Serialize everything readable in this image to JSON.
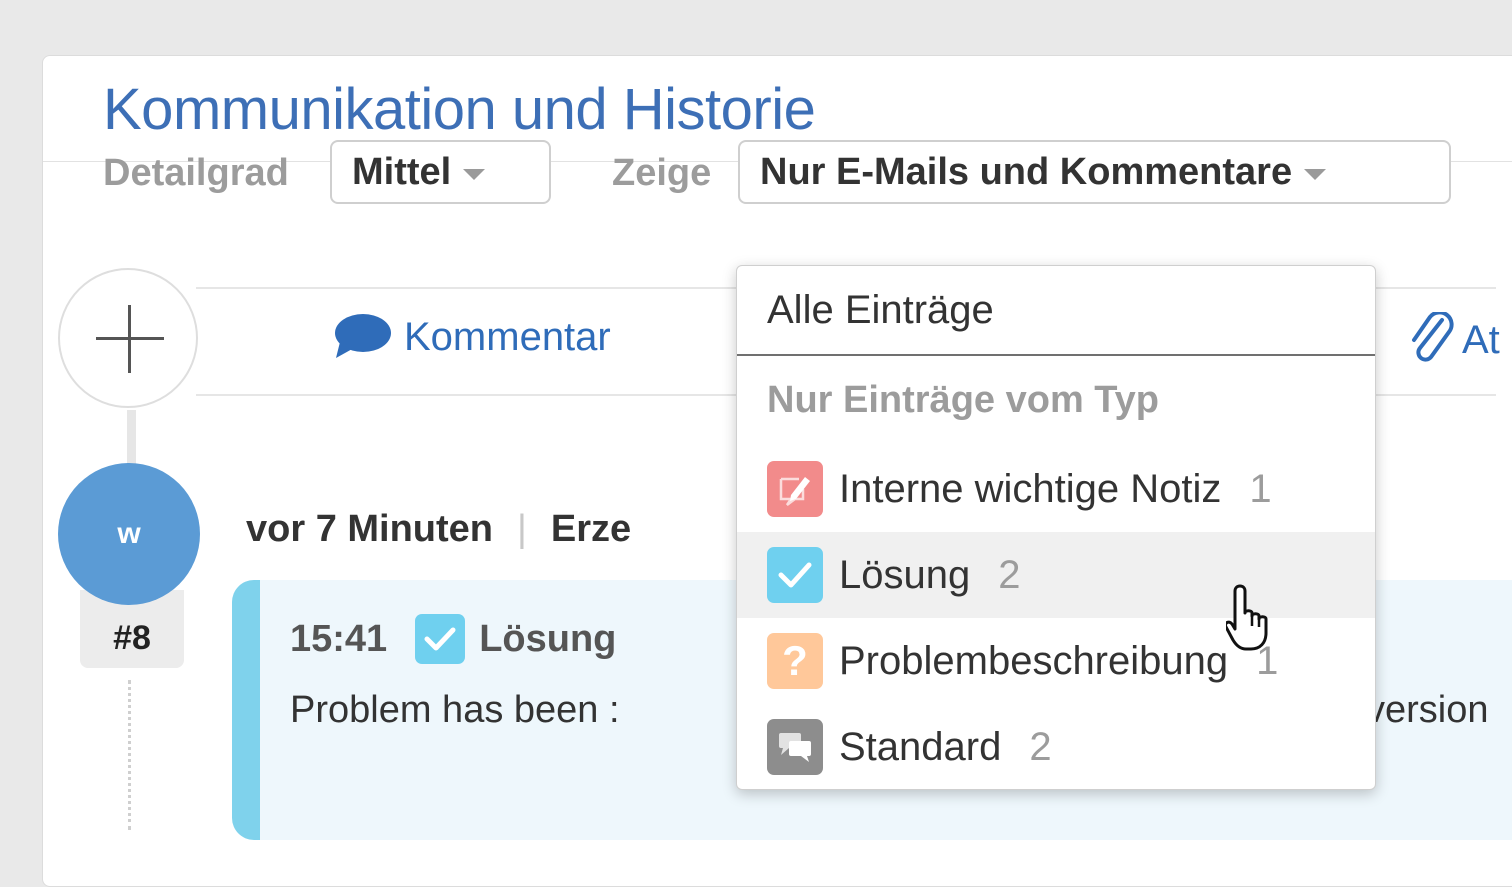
{
  "panel": {
    "title": "Kommunikation und Historie"
  },
  "filters": {
    "detail_label": "Detailgrad",
    "detail_value": "Mittel",
    "show_label": "Zeige",
    "show_value": "Nur E-Mails und Kommentare"
  },
  "actions": {
    "comment_label": "Kommentar",
    "attachment_label_partial": "At"
  },
  "dropdown": {
    "all_entries": "Alle Einträge",
    "type_heading": "Nur Einträge vom Typ",
    "items": [
      {
        "label": "Interne wichtige Notiz",
        "count": "1",
        "icon": "pencil-note-icon",
        "color": "#f28b8b"
      },
      {
        "label": "Lösung",
        "count": "2",
        "icon": "check-icon",
        "color": "#6fd0ef",
        "hover": true
      },
      {
        "label": "Problembeschreibung",
        "count": "1",
        "icon": "question-icon",
        "glyph": "?",
        "color": "#ffc89a"
      },
      {
        "label": "Standard",
        "count": "2",
        "icon": "chat-icon",
        "color": "#8d8d8d"
      }
    ]
  },
  "timeline": {
    "avatar_initial": "w",
    "ticket_number": "#8",
    "time_ago": "vor 7 Minuten",
    "created_partial": "Erze"
  },
  "entry": {
    "time": "15:41",
    "type_label": "Lösung",
    "text_start": "Problem has been :",
    "text_end": "version"
  },
  "colors": {
    "accent_blue": "#3d6fb6",
    "solution_cyan": "#6fd0ef",
    "note_red": "#f28b8b",
    "problem_orange": "#ffc89a",
    "standard_gray": "#8d8d8d"
  }
}
